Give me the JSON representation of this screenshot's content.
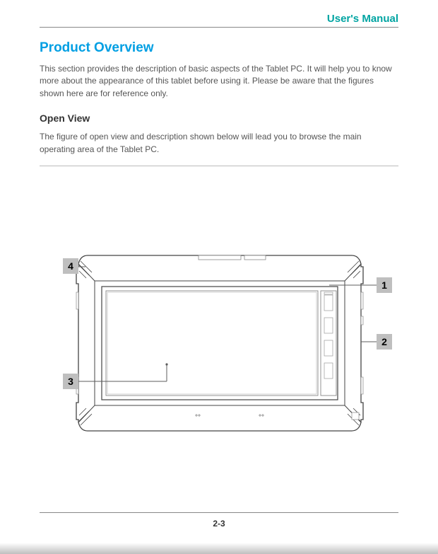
{
  "header": {
    "title": "User's Manual"
  },
  "section": {
    "h1": "Product Overview",
    "intro": "This section provides the description of basic aspects of the Tablet PC. It will help you to know more about the appearance of this tablet before using it. Please be aware that the figures shown here are for reference only.",
    "h2": "Open View",
    "open_view_text": "The figure of open view and description shown below will lead you to browse the main operating area of the Tablet PC."
  },
  "callouts": {
    "c1": "1",
    "c2": "2",
    "c3": "3",
    "c4": "4"
  },
  "footer": {
    "page": "2-3"
  }
}
